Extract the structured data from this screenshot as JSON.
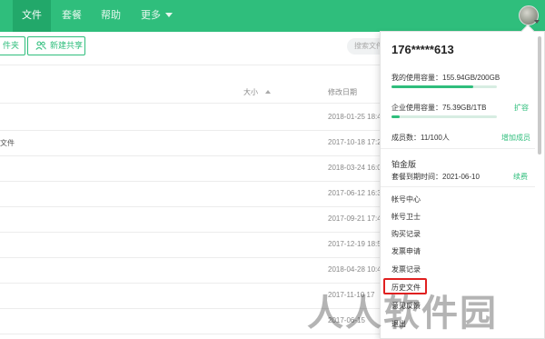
{
  "nav": {
    "items": [
      {
        "label": "文件"
      },
      {
        "label": "套餐"
      },
      {
        "label": "帮助"
      },
      {
        "label": "更多"
      }
    ]
  },
  "toolbar": {
    "partial_button_label": "件夹",
    "share_button_label": "新建共享",
    "search_placeholder": "搜索文件"
  },
  "table": {
    "col_size": "大小",
    "col_date": "修改日期",
    "rows": [
      {
        "name": "",
        "date": "2018-01-25 18:4"
      },
      {
        "name": "文件",
        "date": "2017-10-18 17:2"
      },
      {
        "name": "",
        "date": "2018-03-24 16:0"
      },
      {
        "name": "",
        "date": "2017-06-12 16:3"
      },
      {
        "name": "",
        "date": "2017-09-21 17:4"
      },
      {
        "name": "",
        "date": "2017-12-19 18:5"
      },
      {
        "name": "",
        "date": "2018-04-28 10:4"
      },
      {
        "name": "",
        "date": "2017-11-10 17"
      },
      {
        "name": "",
        "date": "2017-06-15"
      }
    ]
  },
  "account": {
    "phone": "176*****613",
    "personal_usage": "我的使用容量：155.94GB/200GB",
    "personal_usage_fraction": 0.78,
    "enterprise_usage": "企业使用容量：75.39GB/1TB",
    "enterprise_usage_fraction": 0.08,
    "expand_label": "扩容",
    "members": "成员数：11/100人",
    "add_member_label": "增加成员",
    "plan_name": "铂金版",
    "expiry": "套餐到期时间：2021-06-10",
    "renew_label": "续费",
    "menu": [
      {
        "label": "帐号中心"
      },
      {
        "label": "帐号卫士"
      },
      {
        "label": "购买记录"
      },
      {
        "label": "发票申请"
      },
      {
        "label": "发票记录"
      },
      {
        "label": "历史文件"
      },
      {
        "label": "意见反馈"
      },
      {
        "label": "退出"
      }
    ]
  },
  "watermark": "人人软件园",
  "colors": {
    "brand": "#2fbe7c",
    "highlight": "#e02020"
  }
}
